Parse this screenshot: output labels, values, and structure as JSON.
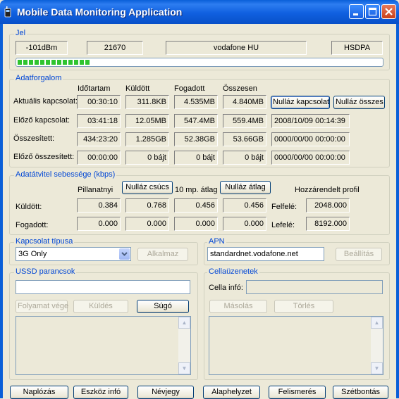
{
  "window": {
    "title": "Mobile Data Monitoring Application"
  },
  "signal": {
    "group_title": "Jel",
    "dbm": "-101dBm",
    "cell_id": "21670",
    "operator": "vodafone HU",
    "network": "HSDPA",
    "strength_fraction": 0.2
  },
  "traffic": {
    "group_title": "Adatforgalom",
    "headers": {
      "duration": "Időtartam",
      "sent": "Küldött",
      "received": "Fogadott",
      "total": "Összesen"
    },
    "rows": [
      {
        "label": "Aktuális kapcsolat:",
        "duration": "00:30:10",
        "sent": "311.8KB",
        "received": "4.535MB",
        "total": "4.840MB"
      },
      {
        "label": "Előző kapcsolat:",
        "duration": "03:41:18",
        "sent": "12.05MB",
        "received": "547.4MB",
        "total": "559.4MB",
        "extra": "2008/10/09 00:14:39"
      },
      {
        "label": "Összesített:",
        "duration": "434:23:20",
        "sent": "1.285GB",
        "received": "52.38GB",
        "total": "53.66GB",
        "extra": "0000/00/00 00:00:00"
      },
      {
        "label": "Előző összesített:",
        "duration": "00:00:00",
        "sent": "0 bájt",
        "received": "0 bájt",
        "total": "0 bájt",
        "extra": "0000/00/00 00:00:00"
      }
    ],
    "reset_connection_label": "Nulláz kapcsolat",
    "reset_all_label": "Nulláz összes"
  },
  "speed": {
    "group_title": "Adatátvitel sebessége (kbps)",
    "instant_label": "Pillanatnyi",
    "reset_peak_label": "Nulláz csúcs",
    "avg_label": "10 mp. átlag",
    "reset_avg_label": "Nulláz átlag",
    "assigned_label": "Hozzárendelt profil",
    "rows": [
      {
        "label": "Küldött:",
        "instant": "0.384",
        "peak": "0.768",
        "avg": "0.456",
        "avg_peak": "0.456",
        "dir_label": "Felfelé:",
        "profile": "2048.000"
      },
      {
        "label": "Fogadott:",
        "instant": "0.000",
        "peak": "0.000",
        "avg": "0.000",
        "avg_peak": "0.000",
        "dir_label": "Lefelé:",
        "profile": "8192.000"
      }
    ]
  },
  "connection_type": {
    "group_title": "Kapcsolat típusa",
    "selected": "3G Only",
    "apply_label": "Alkalmaz"
  },
  "apn": {
    "group_title": "APN",
    "value": "standardnet.vodafone.net",
    "settings_label": "Beállítás"
  },
  "ussd": {
    "group_title": "USSD parancsok",
    "input_value": "",
    "end_session_label": "Folyamat vége",
    "send_label": "Küldés",
    "help_label": "Súgó"
  },
  "cell_broadcast": {
    "group_title": "Cellaüzenetek",
    "cell_info_label": "Cella infó:",
    "cell_info_value": "",
    "copy_label": "Másolás",
    "delete_label": "Törlés"
  },
  "footer": {
    "logging_label": "Naplózás",
    "device_info_label": "Eszköz infó",
    "about_label": "Névjegy",
    "defaults_label": "Alaphelyzet",
    "detect_label": "Felismerés",
    "disconnect_label": "Szétbontás"
  }
}
